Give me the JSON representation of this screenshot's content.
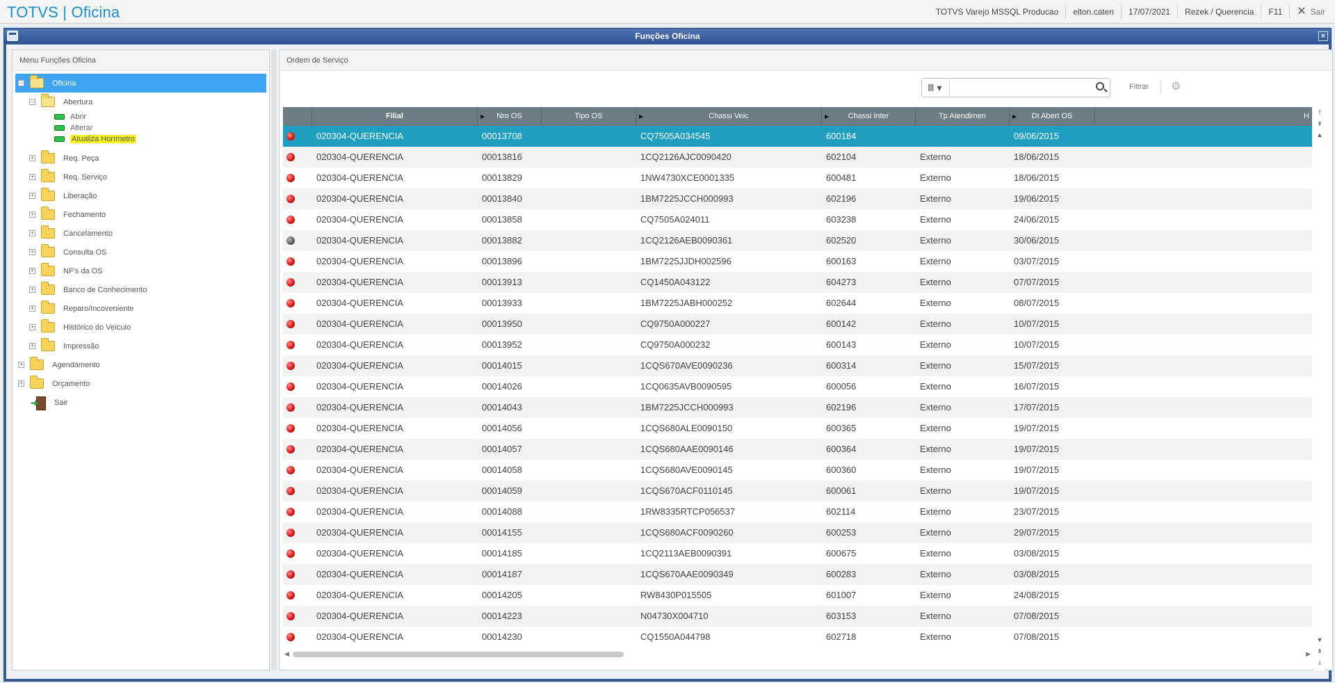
{
  "topbar": {
    "brand": "TOTVS | Oficina",
    "environment": "TOTVS Varejo MSSQL Producao",
    "user": "elton.caten",
    "date": "17/07/2021",
    "branch": "Rezek / Querencia",
    "shortcut": "F11",
    "exit_label": "Sair"
  },
  "window": {
    "title": "Funções Oficina",
    "close": "×"
  },
  "left_panel": {
    "header": "Menu Funções Oficina",
    "root": "Oficina",
    "abertura": {
      "label": "Abertura",
      "children": [
        "Abrir",
        "Alterar",
        "Atualiza Horímetro"
      ]
    },
    "folders": [
      "Req. Peça",
      "Req. Serviço",
      "Liberação",
      "Fechamento",
      "Cancelamento",
      "Consulta OS",
      "NF's da OS",
      "Banco de Conhecimento",
      "Reparo/Incoveniente",
      "Histórico do Veículo",
      "Impressão"
    ],
    "root_folders": [
      "Agendamento",
      "Orçamento"
    ],
    "exit": "Sair"
  },
  "right_panel": {
    "header": "Ordem de Serviço",
    "search_placeholder": "",
    "filter_label": "Filtrar",
    "columns": [
      "",
      "Filial",
      "Nro OS",
      "Tipo OS",
      "Chassi Veic",
      "Chassi Inter",
      "Tp Atendimen",
      "Dt Abert OS",
      "H"
    ],
    "rows": [
      {
        "status": "red",
        "filial": "020304-QUERENCIA",
        "nro": "00013708",
        "tipo": "",
        "chassi": "CQ7505A034545",
        "inter": "600184",
        "tp": "",
        "dt": "09/06/2015"
      },
      {
        "status": "red",
        "filial": "020304-QUERENCIA",
        "nro": "00013816",
        "tipo": "",
        "chassi": "1CQ2126AJC0090420",
        "inter": "602104",
        "tp": "Externo",
        "dt": "18/06/2015"
      },
      {
        "status": "red",
        "filial": "020304-QUERENCIA",
        "nro": "00013829",
        "tipo": "",
        "chassi": "1NW4730XCE0001335",
        "inter": "600481",
        "tp": "Externo",
        "dt": "18/06/2015"
      },
      {
        "status": "red",
        "filial": "020304-QUERENCIA",
        "nro": "00013840",
        "tipo": "",
        "chassi": "1BM7225JCCH000993",
        "inter": "602196",
        "tp": "Externo",
        "dt": "19/06/2015"
      },
      {
        "status": "red",
        "filial": "020304-QUERENCIA",
        "nro": "00013858",
        "tipo": "",
        "chassi": "CQ7505A024011",
        "inter": "603238",
        "tp": "Externo",
        "dt": "24/06/2015"
      },
      {
        "status": "gray",
        "filial": "020304-QUERENCIA",
        "nro": "00013882",
        "tipo": "",
        "chassi": "1CQ2126AEB0090361",
        "inter": "602520",
        "tp": "Externo",
        "dt": "30/06/2015"
      },
      {
        "status": "red",
        "filial": "020304-QUERENCIA",
        "nro": "00013896",
        "tipo": "",
        "chassi": "1BM7225JJDH002596",
        "inter": "600163",
        "tp": "Externo",
        "dt": "03/07/2015"
      },
      {
        "status": "red",
        "filial": "020304-QUERENCIA",
        "nro": "00013913",
        "tipo": "",
        "chassi": "CQ1450A043122",
        "inter": "604273",
        "tp": "Externo",
        "dt": "07/07/2015"
      },
      {
        "status": "red",
        "filial": "020304-QUERENCIA",
        "nro": "00013933",
        "tipo": "",
        "chassi": "1BM7225JABH000252",
        "inter": "602644",
        "tp": "Externo",
        "dt": "08/07/2015"
      },
      {
        "status": "red",
        "filial": "020304-QUERENCIA",
        "nro": "00013950",
        "tipo": "",
        "chassi": "CQ9750A000227",
        "inter": "600142",
        "tp": "Externo",
        "dt": "10/07/2015"
      },
      {
        "status": "red",
        "filial": "020304-QUERENCIA",
        "nro": "00013952",
        "tipo": "",
        "chassi": "CQ9750A000232",
        "inter": "600143",
        "tp": "Externo",
        "dt": "10/07/2015"
      },
      {
        "status": "red",
        "filial": "020304-QUERENCIA",
        "nro": "00014015",
        "tipo": "",
        "chassi": "1CQS670AVE0090236",
        "inter": "600314",
        "tp": "Externo",
        "dt": "15/07/2015"
      },
      {
        "status": "red",
        "filial": "020304-QUERENCIA",
        "nro": "00014026",
        "tipo": "",
        "chassi": "1CQ0635AVB0090595",
        "inter": "600056",
        "tp": "Externo",
        "dt": "16/07/2015"
      },
      {
        "status": "red",
        "filial": "020304-QUERENCIA",
        "nro": "00014043",
        "tipo": "",
        "chassi": "1BM7225JCCH000993",
        "inter": "602196",
        "tp": "Externo",
        "dt": "17/07/2015"
      },
      {
        "status": "red",
        "filial": "020304-QUERENCIA",
        "nro": "00014056",
        "tipo": "",
        "chassi": "1CQS680ALE0090150",
        "inter": "600365",
        "tp": "Externo",
        "dt": "19/07/2015"
      },
      {
        "status": "red",
        "filial": "020304-QUERENCIA",
        "nro": "00014057",
        "tipo": "",
        "chassi": "1CQS680AAE0090146",
        "inter": "600364",
        "tp": "Externo",
        "dt": "19/07/2015"
      },
      {
        "status": "red",
        "filial": "020304-QUERENCIA",
        "nro": "00014058",
        "tipo": "",
        "chassi": "1CQS680AVE0090145",
        "inter": "600360",
        "tp": "Externo",
        "dt": "19/07/2015"
      },
      {
        "status": "red",
        "filial": "020304-QUERENCIA",
        "nro": "00014059",
        "tipo": "",
        "chassi": "1CQS670ACF0110145",
        "inter": "600061",
        "tp": "Externo",
        "dt": "19/07/2015"
      },
      {
        "status": "red",
        "filial": "020304-QUERENCIA",
        "nro": "00014088",
        "tipo": "",
        "chassi": "1RW8335RTCP056537",
        "inter": "602114",
        "tp": "Externo",
        "dt": "23/07/2015"
      },
      {
        "status": "red",
        "filial": "020304-QUERENCIA",
        "nro": "00014155",
        "tipo": "",
        "chassi": "1CQS680ACF0090260",
        "inter": "600253",
        "tp": "Externo",
        "dt": "29/07/2015"
      },
      {
        "status": "red",
        "filial": "020304-QUERENCIA",
        "nro": "00014185",
        "tipo": "",
        "chassi": "1CQ2113AEB0090391",
        "inter": "600675",
        "tp": "Externo",
        "dt": "03/08/2015"
      },
      {
        "status": "red",
        "filial": "020304-QUERENCIA",
        "nro": "00014187",
        "tipo": "",
        "chassi": "1CQS670AAE0090349",
        "inter": "600283",
        "tp": "Externo",
        "dt": "03/08/2015"
      },
      {
        "status": "red",
        "filial": "020304-QUERENCIA",
        "nro": "00014205",
        "tipo": "",
        "chassi": "RW8430P015505",
        "inter": "601007",
        "tp": "Externo",
        "dt": "24/08/2015"
      },
      {
        "status": "red",
        "filial": "020304-QUERENCIA",
        "nro": "00014223",
        "tipo": "",
        "chassi": "N04730X004710",
        "inter": "603153",
        "tp": "Externo",
        "dt": "07/08/2015"
      },
      {
        "status": "red",
        "filial": "020304-QUERENCIA",
        "nro": "00014230",
        "tipo": "",
        "chassi": "CQ1550A044798",
        "inter": "602718",
        "tp": "Externo",
        "dt": "07/08/2015"
      }
    ]
  },
  "colors": {
    "brand": "#1b8fc8",
    "selected_row": "#1e9ec0",
    "tree_selected": "#3fa4f3",
    "highlight": "#f6f21b",
    "status_red": "#d81a1a",
    "status_gray": "#606060"
  },
  "icons": {
    "folder": "folder-icon",
    "leaf": "green-leaf-icon",
    "exit": "exit-door-icon",
    "search": "search-icon",
    "settings": "gear-icon",
    "close": "close-icon"
  }
}
